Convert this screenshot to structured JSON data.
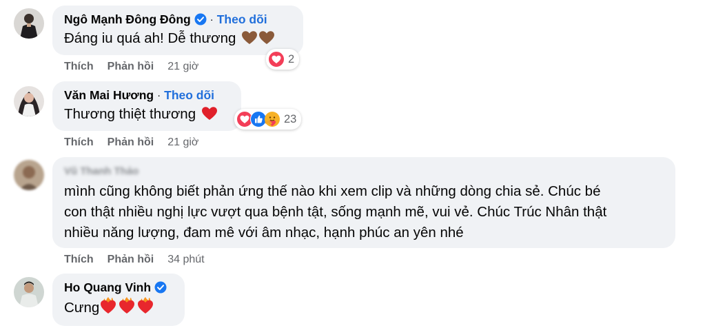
{
  "comments": [
    {
      "author": "Ngô Mạnh Đông Đông",
      "verified": true,
      "follow_label": "Theo dõi",
      "text": "Đáng iu quá ah! Dễ thương",
      "emojis": [
        "brown-heart",
        "brown-heart"
      ],
      "reactions": {
        "icons": [
          "love"
        ],
        "count": "2"
      },
      "like_label": "Thích",
      "reply_label": "Phản hồi",
      "time": "21 giờ"
    },
    {
      "author": "Văn Mai Hương",
      "verified": false,
      "follow_label": "Theo dõi",
      "text": "Thương thiệt thương",
      "emojis": [
        "red-heart"
      ],
      "reactions": {
        "icons": [
          "love",
          "like",
          "care"
        ],
        "count": "23"
      },
      "like_label": "Thích",
      "reply_label": "Phản hồi",
      "time": "21 giờ"
    },
    {
      "author": "Vũ Thanh Thảo",
      "verified": false,
      "text_lines": [
        "mình cũng không biết phản ứng thế nào khi xem clip và những dòng chia sẻ. Chúc bé",
        "con thật nhiều nghị lực vượt qua bệnh tật, sống mạnh mẽ, vui vẻ. Chúc Trúc Nhân thật",
        "nhiều năng lượng, đam mê với âm nhạc, hạnh phúc an yên nhé"
      ],
      "like_label": "Thích",
      "reply_label": "Phản hồi",
      "time": "34 phút"
    },
    {
      "author": "Ho Quang Vinh",
      "verified": true,
      "text": "Cưng",
      "emojis": [
        "heart-on-fire",
        "heart-on-fire",
        "heart-on-fire"
      ]
    }
  ],
  "colors": {
    "bubble": "#f0f2f5",
    "link": "#216fdb",
    "meta": "#65676b",
    "verified": "#1877f2",
    "love": "#f33e58"
  }
}
